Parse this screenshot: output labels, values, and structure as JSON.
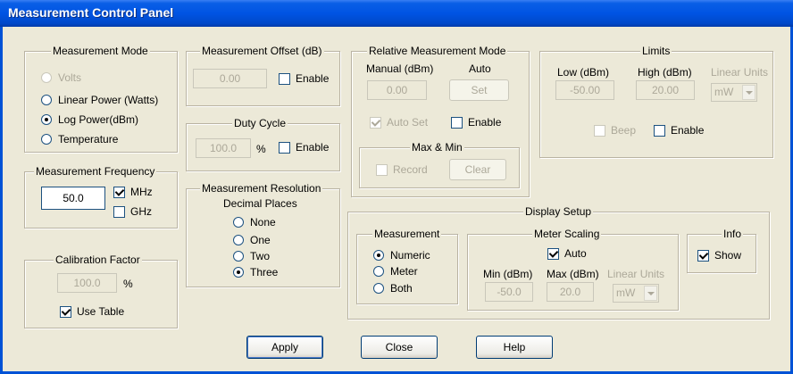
{
  "window": {
    "title": "Measurement Control Panel"
  },
  "measurement_mode": {
    "title": "Measurement Mode",
    "options": [
      "Volts",
      "Linear Power (Watts)",
      "Log Power(dBm)",
      "Temperature"
    ],
    "selected": "Log Power(dBm)"
  },
  "measurement_frequency": {
    "title": "Measurement Frequency",
    "value": "50.0",
    "mhz_label": "MHz",
    "ghz_label": "GHz"
  },
  "calibration_factor": {
    "title": "Calibration Factor",
    "value": "100.0",
    "unit": "%",
    "use_table_label": "Use Table"
  },
  "measurement_offset": {
    "title": "Measurement Offset (dB)",
    "value": "0.00",
    "enable_label": "Enable"
  },
  "duty_cycle": {
    "title": "Duty Cycle",
    "value": "100.0",
    "unit": "%",
    "enable_label": "Enable"
  },
  "measurement_resolution": {
    "title": "Measurement Resolution",
    "subtitle": "Decimal Places",
    "options": [
      "None",
      "One",
      "Two",
      "Three"
    ],
    "selected": "Three"
  },
  "relative_mode": {
    "title": "Relative Measurement Mode",
    "manual_label": "Manual (dBm)",
    "auto_label": "Auto",
    "manual_value": "0.00",
    "set_label": "Set",
    "auto_set_label": "Auto Set",
    "enable_label": "Enable",
    "maxmin": {
      "title": "Max & Min",
      "record_label": "Record",
      "clear_label": "Clear"
    }
  },
  "limits": {
    "title": "Limits",
    "low_label": "Low (dBm)",
    "high_label": "High (dBm)",
    "linear_label": "Linear Units",
    "low_value": "-50.00",
    "high_value": "20.00",
    "units_value": "mW",
    "beep_label": "Beep",
    "enable_label": "Enable"
  },
  "display_setup": {
    "title": "Display Setup",
    "measurement": {
      "title": "Measurement",
      "options": [
        "Numeric",
        "Meter",
        "Both"
      ],
      "selected": "Numeric"
    },
    "meter_scaling": {
      "title": "Meter Scaling",
      "auto_label": "Auto",
      "min_label": "Min (dBm)",
      "max_label": "Max (dBm)",
      "linear_label": "Linear Units",
      "min_value": "-50.0",
      "max_value": "20.0",
      "units_value": "mW"
    },
    "info": {
      "title": "Info",
      "show_label": "Show"
    }
  },
  "buttons": {
    "apply": "Apply",
    "close": "Close",
    "help": "Help"
  }
}
